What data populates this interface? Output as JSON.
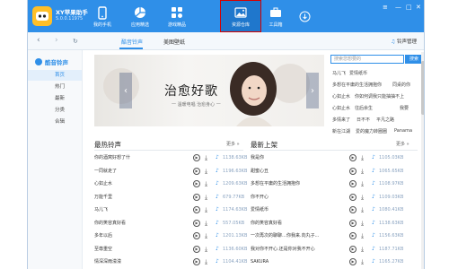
{
  "app": {
    "name": "XY苹果助手",
    "version": "5.0.0.11975"
  },
  "nav": [
    {
      "label": "我的手机",
      "icon": "phone-icon"
    },
    {
      "label": "应用精选",
      "icon": "apps-icon"
    },
    {
      "label": "游戏精品",
      "icon": "gamepad-icon"
    },
    {
      "label": "资源仓库",
      "icon": "image-icon",
      "selected": true
    },
    {
      "label": "工具箱",
      "icon": "toolbox-icon"
    }
  ],
  "window_controls": {
    "menu": "≡",
    "minimize": "—",
    "maximize": "□",
    "close": "✕"
  },
  "tabs": {
    "ringtones": "酷音铃声",
    "wallpapers": "美图壁纸",
    "ring_settings": "铃声管理"
  },
  "sidebar": {
    "title": "酷音铃声",
    "items": [
      "首页",
      "热门",
      "最新",
      "分类",
      "合辑"
    ]
  },
  "banner": {
    "title": "治愈好歌",
    "subtitle": "一 温暖电唱 治愈身心 一"
  },
  "search": {
    "placeholder": "搜索您想要的",
    "button": "搜索"
  },
  "hot_keywords": [
    [
      "马儿飞",
      "爱情纸币"
    ],
    [
      "多想在平庸的生活拥抱你",
      "同桌的你"
    ],
    [
      "心如止水",
      "你如何调我只能抽抽不上"
    ],
    [
      "心如止水",
      "往后余生",
      "我要"
    ],
    [
      "多情来了",
      "日不不",
      "平凡之路"
    ],
    [
      "新在江湖",
      "爱的魔力转圈圈",
      "Panama"
    ]
  ],
  "hot_section": {
    "title": "最热铃声",
    "more": "更多 »"
  },
  "new_section": {
    "title": "最新上架",
    "more": "更多 »"
  },
  "hot_songs": [
    {
      "name": "你的酒窝好想了什",
      "size": "1138.63KB"
    },
    {
      "name": "一同就走了",
      "size": "1196.63KB"
    },
    {
      "name": "心如止水",
      "size": "1209.63KB"
    },
    {
      "name": "万能千里",
      "size": "679.77KB"
    },
    {
      "name": "马儿飞",
      "size": "1174.63KB"
    },
    {
      "name": "你的笑容真好看",
      "size": "557.05KB"
    },
    {
      "name": "多年以后",
      "size": "1201.13KB"
    },
    {
      "name": "至尊重空",
      "size": "1136.60KB"
    },
    {
      "name": "情深深雨濛濛",
      "size": "1104.41KB"
    }
  ],
  "new_songs": [
    {
      "name": "我是你",
      "size": "1105.03KB"
    },
    {
      "name": "甜蜜心丑",
      "size": "1065.65KB"
    },
    {
      "name": "多想在平庸的生活拥抱你",
      "size": "1108.97KB"
    },
    {
      "name": "你不开心",
      "size": "1109.03KB"
    },
    {
      "name": "爱情纸币",
      "size": "1080.41KB"
    },
    {
      "name": "你的笑容真好看",
      "size": "1138.63KB"
    },
    {
      "name": "一次再次的聊聊…你我来.向丸子...",
      "size": "1156.63KB"
    },
    {
      "name": "我对你不开心.还是你对我不开心",
      "size": "1187.71KB"
    },
    {
      "name": "SAKURA",
      "size": "1165.27KB"
    }
  ]
}
